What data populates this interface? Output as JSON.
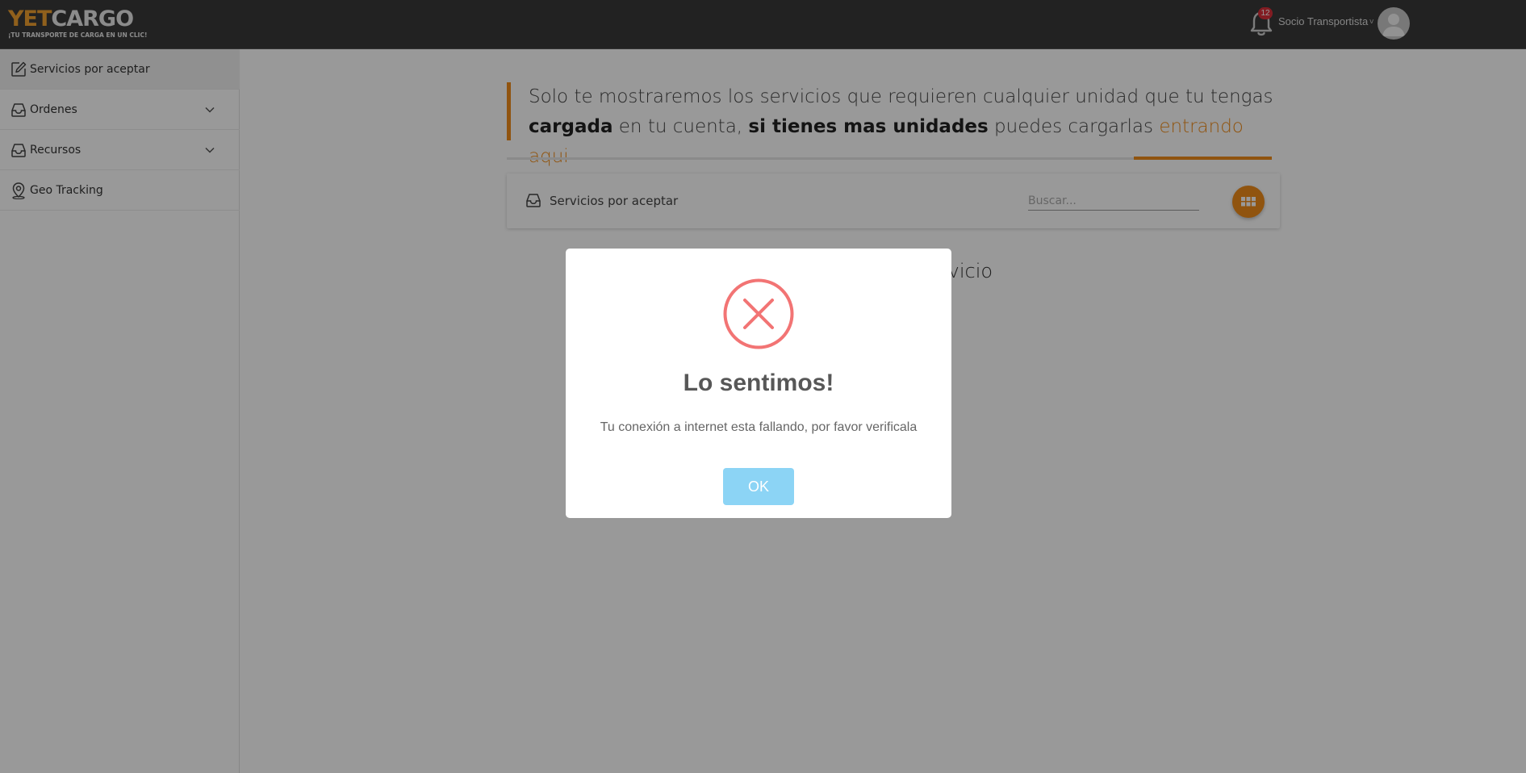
{
  "header": {
    "logo_main_yet": "YET",
    "logo_main_cargo": "CARGO",
    "logo_tagline": "¡TU TRANSPORTE DE CARGA EN UN CLIC!",
    "notification_count": "12",
    "user_name": "Socio Transportista",
    "user_caret": "v"
  },
  "sidebar": {
    "items": [
      {
        "label": "Servicios por aceptar",
        "icon": "edit-icon",
        "active": true
      },
      {
        "label": "Ordenes",
        "icon": "inbox-icon",
        "expandable": true
      },
      {
        "label": "Recursos",
        "icon": "inbox-icon",
        "expandable": true
      },
      {
        "label": "Geo Tracking",
        "icon": "map-pin-icon"
      }
    ]
  },
  "banner": {
    "part1": "Solo te mostraremos los servicios que requieren cualquier unidad que tu tengas ",
    "bold1": "cargada",
    "part2": " en tu cuenta, ",
    "bold2": "si tienes mas unidades",
    "part3": " puedes cargarlas ",
    "link": "entrando aqui"
  },
  "toolbar": {
    "label": "Servicios por aceptar",
    "search_placeholder": "Buscar..."
  },
  "background_text": "ervicio",
  "modal": {
    "title": "Lo sentimos!",
    "message": "Tu conexión a internet esta fallando, por favor verificala",
    "ok_label": "OK"
  },
  "colors": {
    "accent": "#f08c1a",
    "topbar": "#3a3a3a",
    "error": "#f27474",
    "ok_button": "#8cd4f5"
  }
}
